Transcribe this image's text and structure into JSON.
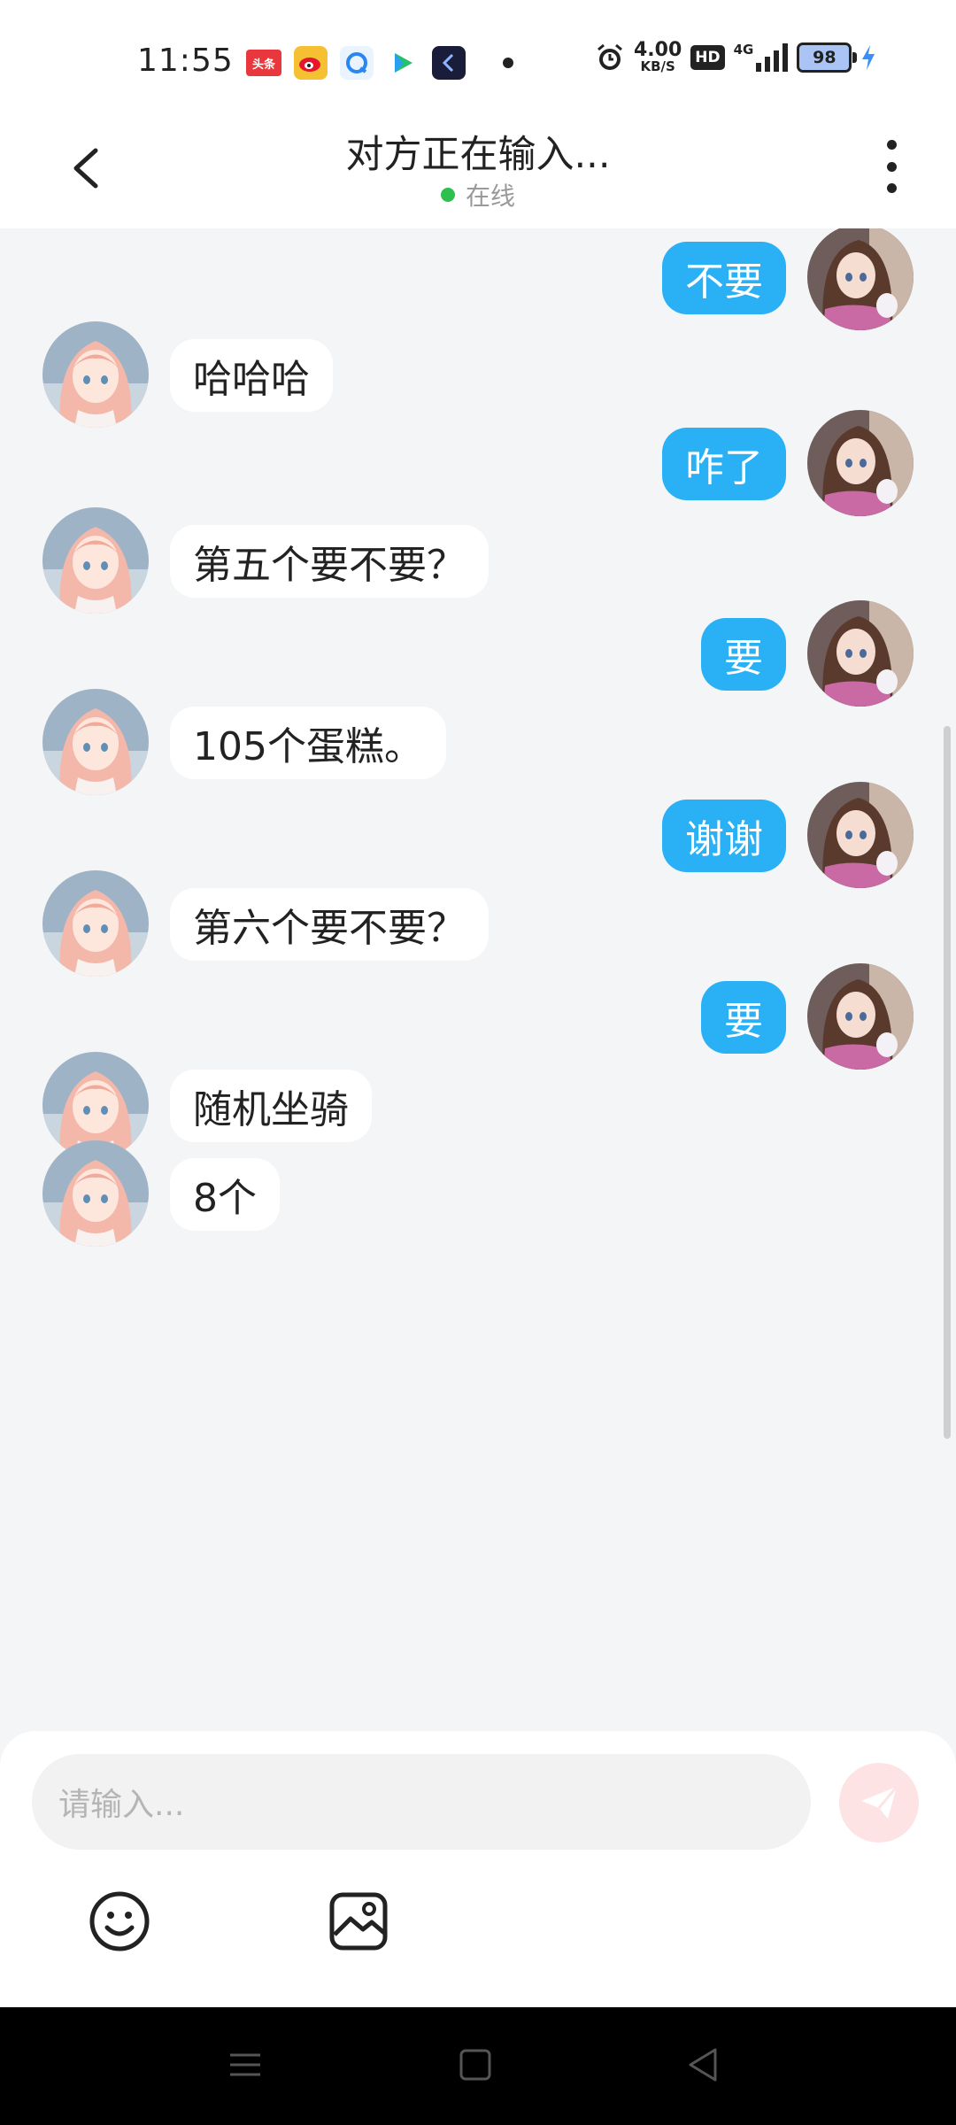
{
  "status_bar": {
    "time": "11:55",
    "app_badges": [
      "头条"
    ],
    "net_speed_value": "4.00",
    "net_speed_unit": "KB/S",
    "hd_label": "HD",
    "network": "4G",
    "battery": "98"
  },
  "header": {
    "title": "对方正在输入...",
    "presence": "在线"
  },
  "messages": [
    {
      "side": "right",
      "text": "不要"
    },
    {
      "side": "left",
      "text": "哈哈哈"
    },
    {
      "side": "right",
      "text": "咋了"
    },
    {
      "side": "left",
      "text": "第五个要不要？"
    },
    {
      "side": "right",
      "text": "要"
    },
    {
      "side": "left",
      "text": "105个蛋糕。"
    },
    {
      "side": "right",
      "text": "谢谢"
    },
    {
      "side": "left",
      "text": "第六个要不要？"
    },
    {
      "side": "right",
      "text": "要"
    },
    {
      "side": "left",
      "text": "随机坐骑"
    },
    {
      "side": "left",
      "text": "8个"
    }
  ],
  "composer": {
    "placeholder": "请输入..."
  },
  "colors": {
    "outgoing_bubble": "#29b0f5",
    "incoming_bubble": "#ffffff",
    "online_dot": "#2ec04f",
    "send_button": "#fde3e3"
  }
}
